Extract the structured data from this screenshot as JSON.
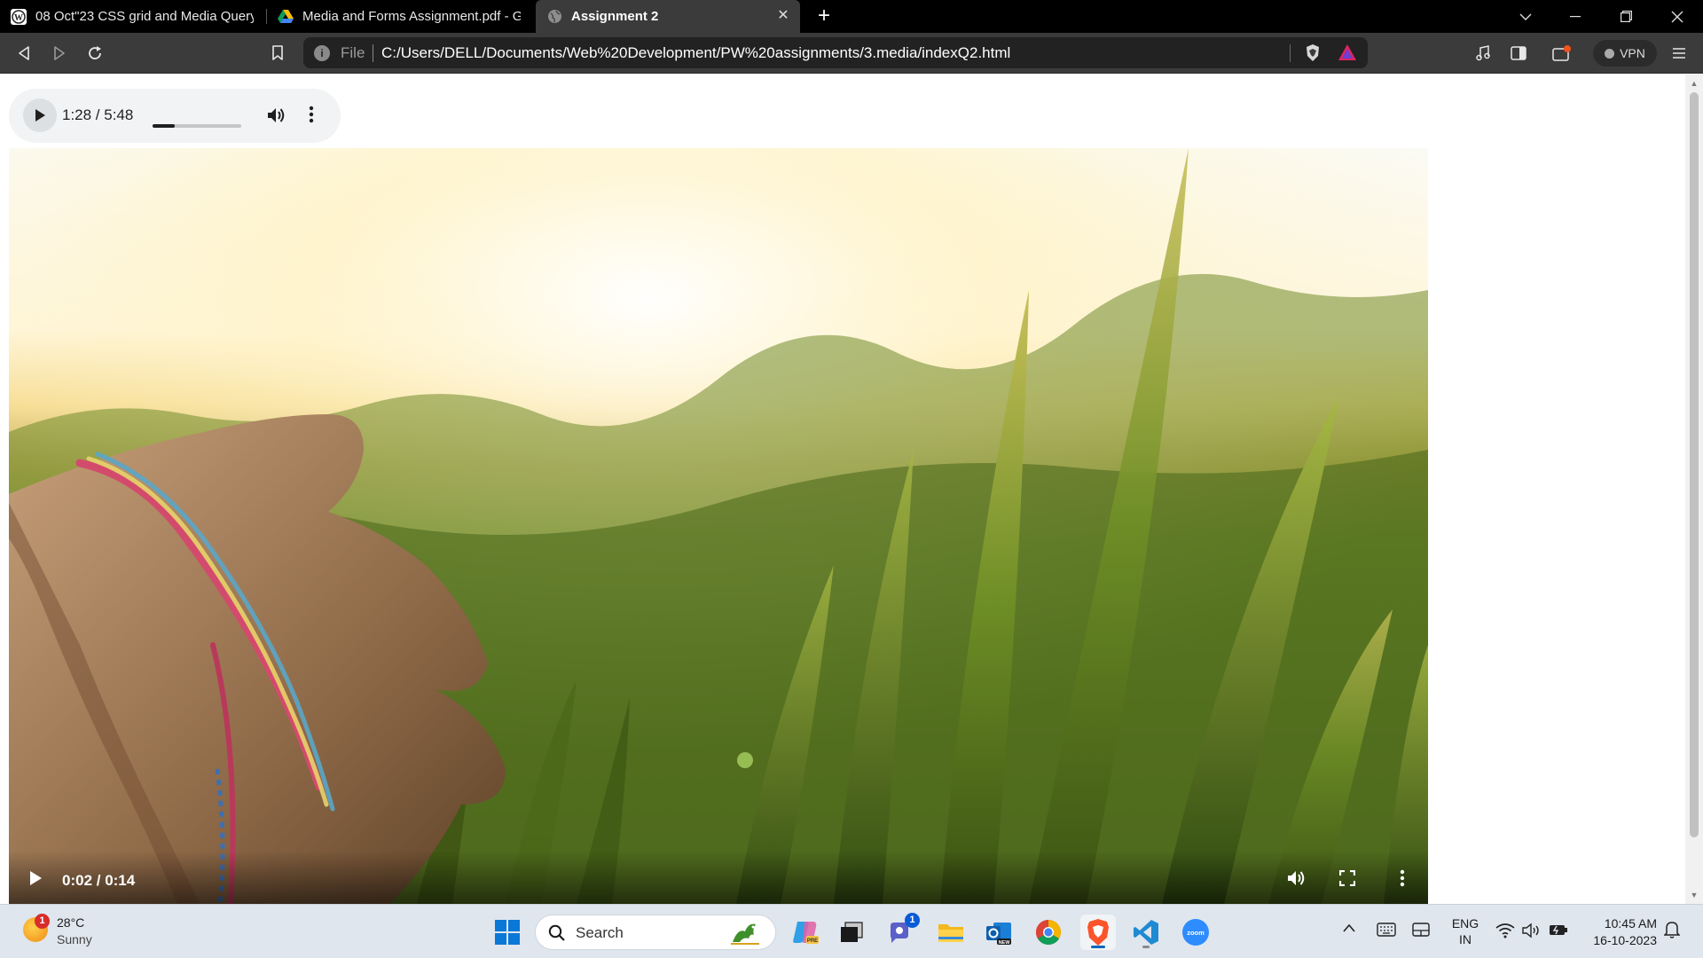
{
  "browser": {
    "tabs": [
      {
        "title": "08 Oct\"23 CSS grid and Media Query -",
        "icon": "wordpress-icon",
        "active": false
      },
      {
        "title": "Media and Forms Assignment.pdf - Go",
        "icon": "google-drive-icon",
        "active": false
      },
      {
        "title": "Assignment 2",
        "icon": "globe-icon",
        "active": true
      }
    ],
    "address": {
      "scheme": "File",
      "url": "C:/Users/DELL/Documents/Web%20Development/PW%20assignments/3.media/indexQ2.html"
    },
    "vpn_label": "VPN"
  },
  "page": {
    "audio_player": {
      "time": "1:28 / 5:48",
      "progress": 0.253
    },
    "video_player": {
      "time": "0:02 / 0:14",
      "progress": 0.143
    }
  },
  "taskbar": {
    "weather": {
      "temp": "28°C",
      "desc": "Sunny",
      "badge": "1"
    },
    "search_placeholder": "Search",
    "teams_badge": "1",
    "language": {
      "line1": "ENG",
      "line2": "IN"
    },
    "clock": {
      "time": "10:45 AM",
      "date": "16-10-2023"
    }
  },
  "colors": {
    "tab_strip": "#000000",
    "toolbar": "#3b3b3b",
    "taskbar": "#dfe6ee",
    "accent": "#0067c0"
  }
}
